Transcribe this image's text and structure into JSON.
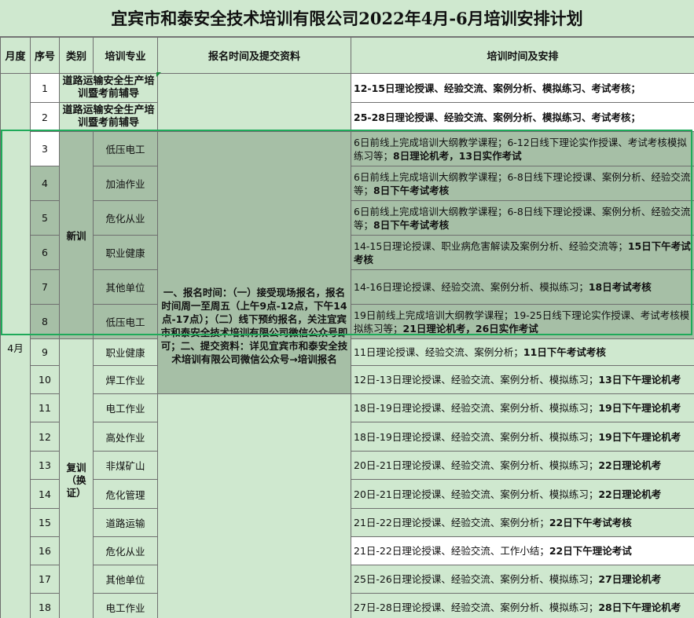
{
  "title": "宜宾市和泰安全技术培训有限公司2022年4月-6月培训安排计划",
  "headers": [
    "月度",
    "序号",
    "类别",
    "培训专业",
    "报名时间及提交资料",
    "培训时间及安排"
  ],
  "month": "4月",
  "categories": {
    "new": "新训",
    "renew": "复训（换证）"
  },
  "registration": "一、报名时间：（一）接受现场报名，报名时间周一至周五（上午9点-12点，下午14点-17点）；（二）线下预约报名，关注宜宾市和泰安全技术培训有限公司微信公众号即可；二、提交资料：详见宜宾市和泰安全技术培训有限公司微信公众号→培训报名",
  "rows": [
    {
      "no": "1",
      "major": "道路运输安全生产培训暨考前辅导",
      "schedule": "12-15日理论授课、经验交流、案例分析、模拟练习、考试考核；"
    },
    {
      "no": "2",
      "major": "道路运输安全生产培训暨考前辅导",
      "schedule": "25-28日理论授课、经验交流、案例分析、模拟练习、考试考核；"
    },
    {
      "no": "3",
      "major": "低压电工",
      "schedule_a": "6日前线上完成培训大纲教学课程；6-12日线下理论实作授课、考试考核模拟练习等；",
      "schedule_b": "8日理论机考，13日实作考试"
    },
    {
      "no": "4",
      "major": "加油作业",
      "schedule_a": "6日前线上完成培训大纲教学课程；6-8日线下理论授课、案例分析、经验交流等；",
      "schedule_b": "8日下午考试考核"
    },
    {
      "no": "5",
      "major": "危化从业",
      "schedule_a": "6日前线上完成培训大纲教学课程；6-8日线下理论授课、案例分析、经验交流等；",
      "schedule_b": "8日下午考试考核"
    },
    {
      "no": "6",
      "major": "职业健康",
      "schedule_a": "14-15日理论授课、职业病危害解读及案例分析、经验交流等；",
      "schedule_b": "15日下午考试考核"
    },
    {
      "no": "7",
      "major": "其他单位",
      "schedule_a": "14-16日理论授课、经验交流、案例分析、模拟练习；",
      "schedule_b": "18日考试考核"
    },
    {
      "no": "8",
      "major": "低压电工",
      "schedule_a": "19日前线上完成培训大纲教学课程；19-25日线下理论实作授课、考试考核模拟练习等；",
      "schedule_b": "21日理论机考，26日实作考试"
    },
    {
      "no": "9",
      "major": "职业健康",
      "schedule_a": "11日理论授课、经验交流、案例分析；",
      "schedule_b": "11日下午考试考核"
    },
    {
      "no": "10",
      "major": "焊工作业",
      "schedule_a": "12日-13日理论授课、经验交流、案例分析、模拟练习；",
      "schedule_b": "13日下午理论机考"
    },
    {
      "no": "11",
      "major": "电工作业",
      "schedule_a": "18日-19日理论授课、经验交流、案例分析、模拟练习；",
      "schedule_b": "19日下午理论机考"
    },
    {
      "no": "12",
      "major": "高处作业",
      "schedule_a": "18日-19日理论授课、经验交流、案例分析、模拟练习；",
      "schedule_b": "19日下午理论机考"
    },
    {
      "no": "13",
      "major": "非煤矿山",
      "schedule_a": "20日-21日理论授课、经验交流、案例分析、模拟练习；",
      "schedule_b": "22日理论机考"
    },
    {
      "no": "14",
      "major": "危化管理",
      "schedule_a": "20日-21日理论授课、经验交流、案例分析、模拟练习；",
      "schedule_b": "22日理论机考"
    },
    {
      "no": "15",
      "major": "道路运输",
      "schedule_a": "21日-22日理论授课、经验交流、案例分析；",
      "schedule_b": "22日下午考试考核"
    },
    {
      "no": "16",
      "major": "危化从业",
      "schedule_a": "21日-22日理论授课、经验交流、工作小结；",
      "schedule_b": "22日下午理论考试"
    },
    {
      "no": "17",
      "major": "其他单位",
      "schedule_a": "25日-26日理论授课、经验交流、案例分析、模拟练习；",
      "schedule_b": "27日理论机考"
    },
    {
      "no": "18",
      "major": "电工作业",
      "schedule_a": "27日-28日理论授课、经验交流、案例分析、模拟练习；",
      "schedule_b": "28日下午理论机考"
    }
  ]
}
